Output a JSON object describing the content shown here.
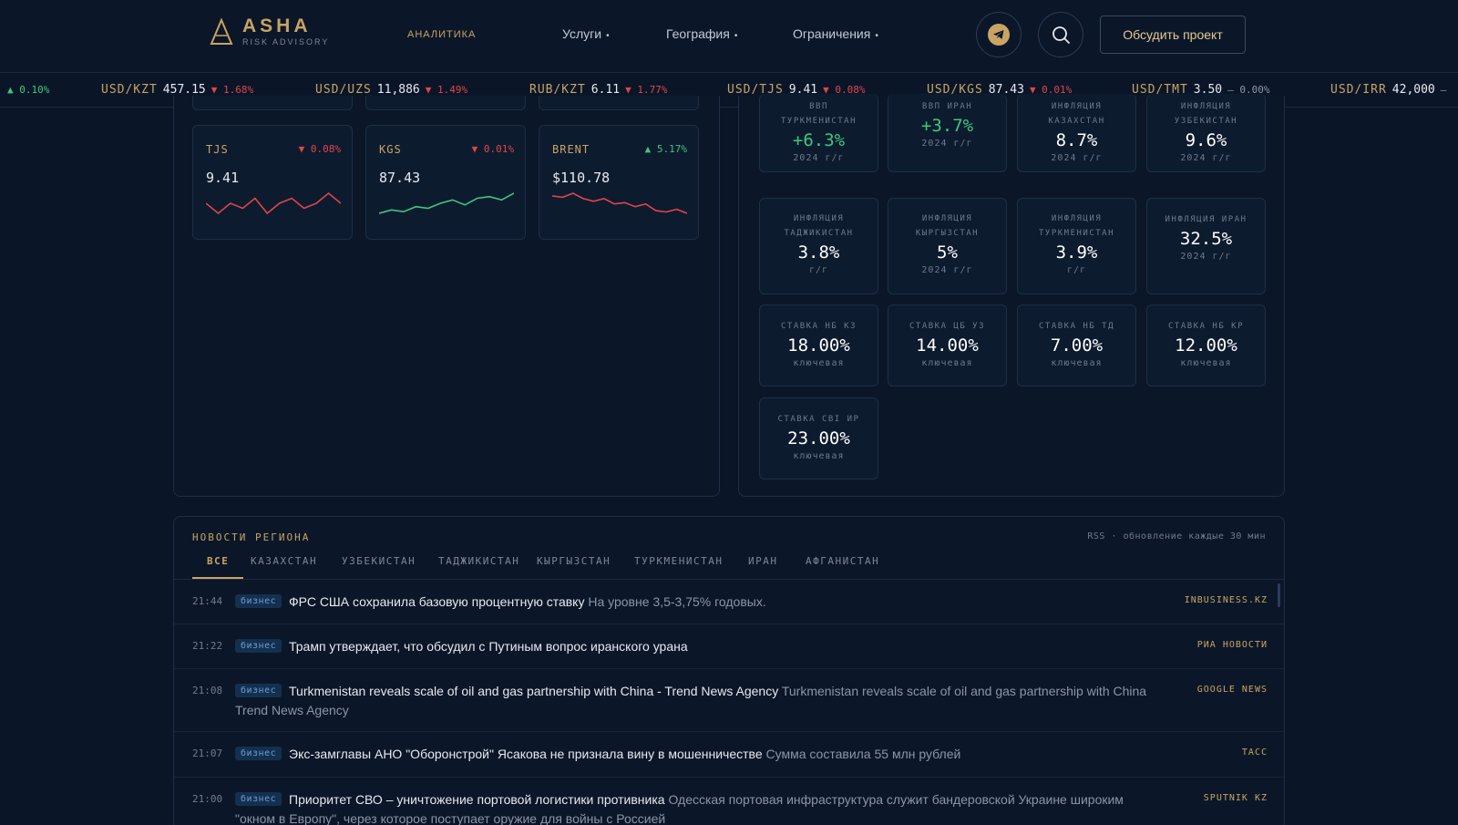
{
  "header": {
    "logo_name": "ASHA",
    "logo_sub": "RISK ADVISORY",
    "nav": {
      "analytics": "АНАЛИТИКА",
      "services": "Услуги",
      "geography": "География",
      "restrictions": "Ограничения"
    },
    "cta": "Обсудить проект"
  },
  "ticker": [
    {
      "sym": "",
      "val": "",
      "chg": "0.10%",
      "dir": "up"
    },
    {
      "sym": "USD/KZT",
      "val": "457.15",
      "chg": "1.68%",
      "dir": "down"
    },
    {
      "sym": "USD/UZS",
      "val": "11,886",
      "chg": "1.49%",
      "dir": "down"
    },
    {
      "sym": "RUB/KZT",
      "val": "6.11",
      "chg": "1.77%",
      "dir": "down"
    },
    {
      "sym": "USD/TJS",
      "val": "9.41",
      "chg": "0.08%",
      "dir": "down"
    },
    {
      "sym": "USD/KGS",
      "val": "87.43",
      "chg": "0.01%",
      "dir": "down"
    },
    {
      "sym": "USD/TMT",
      "val": "3.50",
      "chg": "0.00%",
      "dir": "flat"
    },
    {
      "sym": "USD/IRR",
      "val": "42,000",
      "chg": "",
      "dir": "flat"
    }
  ],
  "currencies": [
    {
      "code": "TJS",
      "value": "9.41",
      "change": "0.08%",
      "dir": "down",
      "color": "#e0454b",
      "spark": [
        6,
        5,
        6,
        5.5,
        6.5,
        5,
        6,
        6.5,
        5.5,
        6,
        7,
        6
      ]
    },
    {
      "code": "KGS",
      "value": "87.43",
      "change": "0.01%",
      "dir": "down",
      "color": "#3ec77e",
      "spark": [
        3,
        4,
        3.5,
        5,
        4.5,
        6,
        7,
        5.5,
        7.5,
        8,
        7,
        9
      ]
    },
    {
      "code": "BRENT",
      "value": "$110.78",
      "change": "5.17%",
      "dir": "up",
      "color": "#e0454b",
      "spark": [
        9,
        8.5,
        10,
        8,
        7,
        8,
        6,
        6.5,
        5,
        6,
        3.5,
        3,
        4,
        2.5
      ]
    }
  ],
  "stats": [
    {
      "label": "ВВП ТУРКМЕНИСТАН",
      "value": "+6.3%",
      "sub": "2024 г/г",
      "positive": true
    },
    {
      "label": "ВВП ИРАН",
      "value": "+3.7%",
      "sub": "2024 г/г",
      "positive": true
    },
    {
      "label": "ИНФЛЯЦИЯ КАЗАХСТАН",
      "value": "8.7%",
      "sub": "2024 г/г",
      "positive": false
    },
    {
      "label": "ИНФЛЯЦИЯ УЗБЕКИСТАН",
      "value": "9.6%",
      "sub": "2024 г/г",
      "positive": false
    },
    {
      "label": "ИНФЛЯЦИЯ ТАДЖИКИСТАН",
      "value": "3.8%",
      "sub": "г/г",
      "positive": false
    },
    {
      "label": "ИНФЛЯЦИЯ КЫРГЫЗСТАН",
      "value": "5%",
      "sub": "2024 г/г",
      "positive": false
    },
    {
      "label": "ИНФЛЯЦИЯ ТУРКМЕНИСТАН",
      "value": "3.9%",
      "sub": "г/г",
      "positive": false
    },
    {
      "label": "ИНФЛЯЦИЯ ИРАН",
      "value": "32.5%",
      "sub": "2024 г/г",
      "positive": false
    },
    {
      "label": "СТАВКА НБ КЗ",
      "value": "18.00%",
      "sub": "ключевая",
      "positive": false
    },
    {
      "label": "СТАВКА ЦБ УЗ",
      "value": "14.00%",
      "sub": "ключевая",
      "positive": false
    },
    {
      "label": "СТАВКА НБ ТД",
      "value": "7.00%",
      "sub": "ключевая",
      "positive": false
    },
    {
      "label": "СТАВКА НБ КР",
      "value": "12.00%",
      "sub": "ключевая",
      "positive": false
    },
    {
      "label": "СТАВКА CBI ИР",
      "value": "23.00%",
      "sub": "ключевая",
      "positive": false
    }
  ],
  "news": {
    "title": "НОВОСТИ РЕГИОНА",
    "meta": "RSS · обновление каждые 30 мин",
    "tabs": [
      "ВСЕ",
      "КАЗАХСТАН",
      "УЗБЕКИСТАН",
      "ТАДЖИКИСТАН",
      "КЫРГЫЗСТАН",
      "ТУРКМЕНИСТАН",
      "ИРАН",
      "АФГАНИСТАН"
    ],
    "items": [
      {
        "time": "21:44",
        "badge": "бизнес",
        "headline": "ФРС США сохранила базовую процентную ставку",
        "desc": "На уровне 3,5-3,75% годовых.",
        "source": "INBUSINESS.KZ"
      },
      {
        "time": "21:22",
        "badge": "бизнес",
        "headline": "Трамп утверждает, что обсудил с Путиным вопрос иранского урана",
        "desc": "",
        "source": "РИА НОВОСТИ"
      },
      {
        "time": "21:08",
        "badge": "бизнес",
        "headline": "Turkmenistan reveals scale of oil and gas partnership with China - Trend News Agency",
        "desc": "Turkmenistan reveals scale of oil and gas partnership with China  Trend News Agency",
        "source": "GOOGLE NEWS"
      },
      {
        "time": "21:07",
        "badge": "бизнес",
        "headline": "Экс-замглавы АНО \"Оборонстрой\" Ясакова не признала вину в мошенничестве",
        "desc": "Сумма составила 55 млн рублей",
        "source": "ТАСС"
      },
      {
        "time": "21:00",
        "badge": "бизнес",
        "headline": "Приоритет СВО – уничтожение портовой логистики противника",
        "desc": "Одесская портовая инфраструктура служит бандеровской Украине широким \"окном в Европу\", через которое поступает оружие для войны с Россией",
        "source": "SPUTNIK KZ"
      }
    ]
  }
}
